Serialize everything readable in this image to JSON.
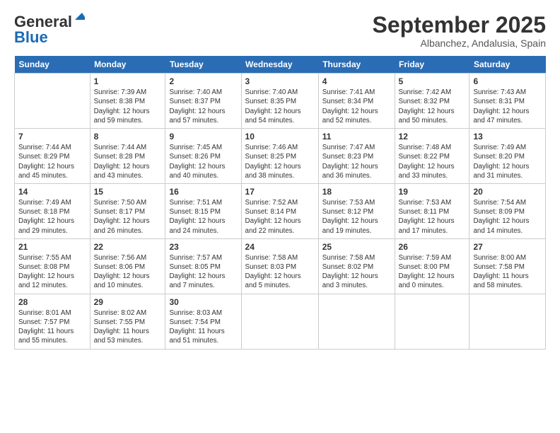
{
  "header": {
    "logo_general": "General",
    "logo_blue": "Blue",
    "month": "September 2025",
    "location": "Albanchez, Andalusia, Spain"
  },
  "days_of_week": [
    "Sunday",
    "Monday",
    "Tuesday",
    "Wednesday",
    "Thursday",
    "Friday",
    "Saturday"
  ],
  "weeks": [
    [
      {
        "day": "",
        "info": ""
      },
      {
        "day": "1",
        "info": "Sunrise: 7:39 AM\nSunset: 8:38 PM\nDaylight: 12 hours\nand 59 minutes."
      },
      {
        "day": "2",
        "info": "Sunrise: 7:40 AM\nSunset: 8:37 PM\nDaylight: 12 hours\nand 57 minutes."
      },
      {
        "day": "3",
        "info": "Sunrise: 7:40 AM\nSunset: 8:35 PM\nDaylight: 12 hours\nand 54 minutes."
      },
      {
        "day": "4",
        "info": "Sunrise: 7:41 AM\nSunset: 8:34 PM\nDaylight: 12 hours\nand 52 minutes."
      },
      {
        "day": "5",
        "info": "Sunrise: 7:42 AM\nSunset: 8:32 PM\nDaylight: 12 hours\nand 50 minutes."
      },
      {
        "day": "6",
        "info": "Sunrise: 7:43 AM\nSunset: 8:31 PM\nDaylight: 12 hours\nand 47 minutes."
      }
    ],
    [
      {
        "day": "7",
        "info": "Sunrise: 7:44 AM\nSunset: 8:29 PM\nDaylight: 12 hours\nand 45 minutes."
      },
      {
        "day": "8",
        "info": "Sunrise: 7:44 AM\nSunset: 8:28 PM\nDaylight: 12 hours\nand 43 minutes."
      },
      {
        "day": "9",
        "info": "Sunrise: 7:45 AM\nSunset: 8:26 PM\nDaylight: 12 hours\nand 40 minutes."
      },
      {
        "day": "10",
        "info": "Sunrise: 7:46 AM\nSunset: 8:25 PM\nDaylight: 12 hours\nand 38 minutes."
      },
      {
        "day": "11",
        "info": "Sunrise: 7:47 AM\nSunset: 8:23 PM\nDaylight: 12 hours\nand 36 minutes."
      },
      {
        "day": "12",
        "info": "Sunrise: 7:48 AM\nSunset: 8:22 PM\nDaylight: 12 hours\nand 33 minutes."
      },
      {
        "day": "13",
        "info": "Sunrise: 7:49 AM\nSunset: 8:20 PM\nDaylight: 12 hours\nand 31 minutes."
      }
    ],
    [
      {
        "day": "14",
        "info": "Sunrise: 7:49 AM\nSunset: 8:18 PM\nDaylight: 12 hours\nand 29 minutes."
      },
      {
        "day": "15",
        "info": "Sunrise: 7:50 AM\nSunset: 8:17 PM\nDaylight: 12 hours\nand 26 minutes."
      },
      {
        "day": "16",
        "info": "Sunrise: 7:51 AM\nSunset: 8:15 PM\nDaylight: 12 hours\nand 24 minutes."
      },
      {
        "day": "17",
        "info": "Sunrise: 7:52 AM\nSunset: 8:14 PM\nDaylight: 12 hours\nand 22 minutes."
      },
      {
        "day": "18",
        "info": "Sunrise: 7:53 AM\nSunset: 8:12 PM\nDaylight: 12 hours\nand 19 minutes."
      },
      {
        "day": "19",
        "info": "Sunrise: 7:53 AM\nSunset: 8:11 PM\nDaylight: 12 hours\nand 17 minutes."
      },
      {
        "day": "20",
        "info": "Sunrise: 7:54 AM\nSunset: 8:09 PM\nDaylight: 12 hours\nand 14 minutes."
      }
    ],
    [
      {
        "day": "21",
        "info": "Sunrise: 7:55 AM\nSunset: 8:08 PM\nDaylight: 12 hours\nand 12 minutes."
      },
      {
        "day": "22",
        "info": "Sunrise: 7:56 AM\nSunset: 8:06 PM\nDaylight: 12 hours\nand 10 minutes."
      },
      {
        "day": "23",
        "info": "Sunrise: 7:57 AM\nSunset: 8:05 PM\nDaylight: 12 hours\nand 7 minutes."
      },
      {
        "day": "24",
        "info": "Sunrise: 7:58 AM\nSunset: 8:03 PM\nDaylight: 12 hours\nand 5 minutes."
      },
      {
        "day": "25",
        "info": "Sunrise: 7:58 AM\nSunset: 8:02 PM\nDaylight: 12 hours\nand 3 minutes."
      },
      {
        "day": "26",
        "info": "Sunrise: 7:59 AM\nSunset: 8:00 PM\nDaylight: 12 hours\nand 0 minutes."
      },
      {
        "day": "27",
        "info": "Sunrise: 8:00 AM\nSunset: 7:58 PM\nDaylight: 11 hours\nand 58 minutes."
      }
    ],
    [
      {
        "day": "28",
        "info": "Sunrise: 8:01 AM\nSunset: 7:57 PM\nDaylight: 11 hours\nand 55 minutes."
      },
      {
        "day": "29",
        "info": "Sunrise: 8:02 AM\nSunset: 7:55 PM\nDaylight: 11 hours\nand 53 minutes."
      },
      {
        "day": "30",
        "info": "Sunrise: 8:03 AM\nSunset: 7:54 PM\nDaylight: 11 hours\nand 51 minutes."
      },
      {
        "day": "",
        "info": ""
      },
      {
        "day": "",
        "info": ""
      },
      {
        "day": "",
        "info": ""
      },
      {
        "day": "",
        "info": ""
      }
    ]
  ]
}
